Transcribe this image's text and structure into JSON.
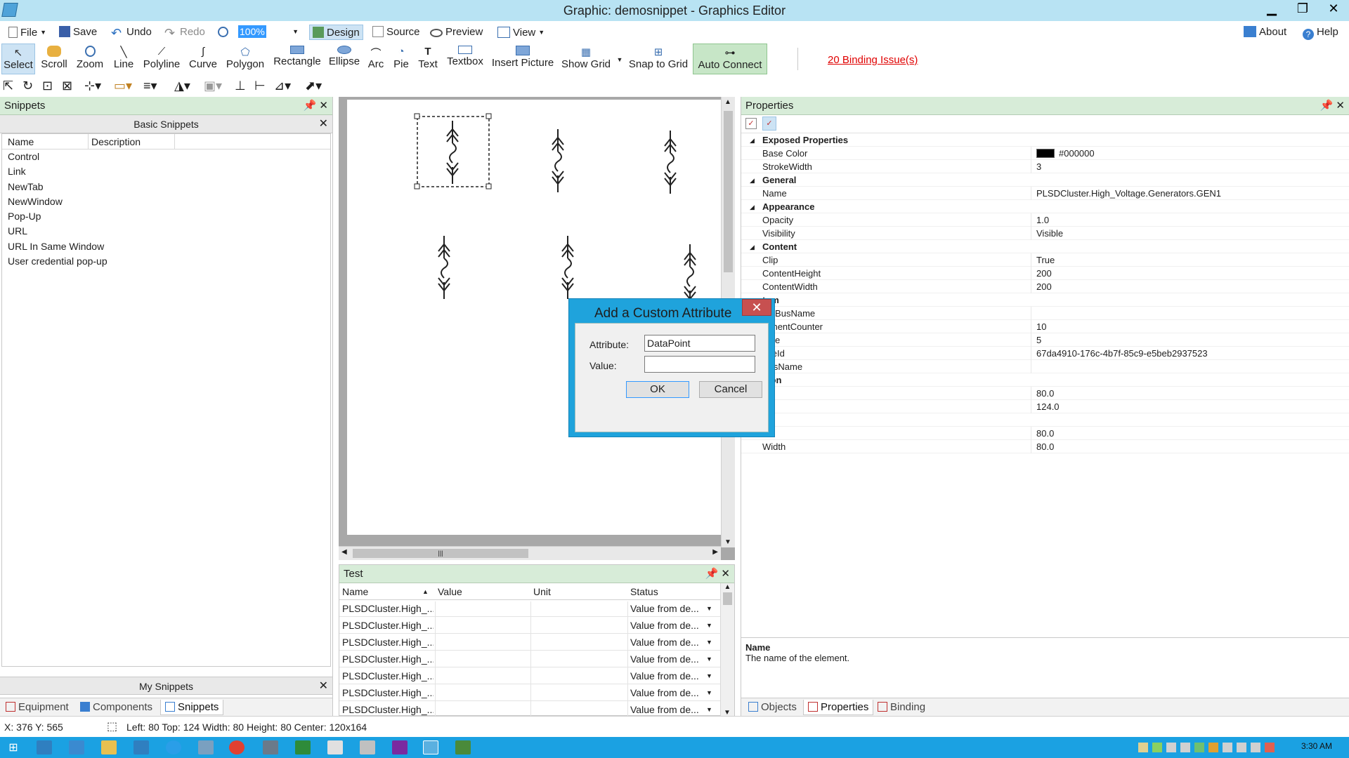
{
  "window": {
    "title": "Graphic: demosnippet - Graphics Editor",
    "min": "▁",
    "max": "❐",
    "close": "✕"
  },
  "menu": {
    "file": "File",
    "save": "Save",
    "undo": "Undo",
    "redo": "Redo",
    "zoom": "100%",
    "design": "Design",
    "source": "Source",
    "preview": "Preview",
    "view": "View",
    "about": "About",
    "help": "Help"
  },
  "tools": [
    {
      "label": "Select",
      "icon": "arrow-icon"
    },
    {
      "label": "Scroll",
      "icon": "hand-icon"
    },
    {
      "label": "Zoom",
      "icon": "magnifier-icon"
    },
    {
      "label": "Line",
      "icon": "line-icon"
    },
    {
      "label": "Polyline",
      "icon": "polyline-icon"
    },
    {
      "label": "Curve",
      "icon": "curve-icon"
    },
    {
      "label": "Polygon",
      "icon": "polygon-icon"
    },
    {
      "label": "Rectangle",
      "icon": "rectangle-icon"
    },
    {
      "label": "Ellipse",
      "icon": "ellipse-icon"
    },
    {
      "label": "Arc",
      "icon": "arc-icon"
    },
    {
      "label": "Pie",
      "icon": "pie-icon"
    },
    {
      "label": "Text",
      "icon": "text-icon"
    },
    {
      "label": "Textbox",
      "icon": "textbox-icon"
    },
    {
      "label": "Insert Picture",
      "icon": "picture-icon"
    },
    {
      "label": "Show Grid",
      "icon": "grid-icon"
    },
    {
      "label": "Snap to Grid",
      "icon": "snap-icon"
    },
    {
      "label": "Auto Connect",
      "icon": "connect-icon"
    }
  ],
  "binding_issues": "20 Binding Issue(s)",
  "snippets": {
    "title": "Snippets",
    "basic_title": "Basic Snippets",
    "col_name": "Name",
    "col_desc": "Description",
    "items": [
      "Control",
      "Link",
      "NewTab",
      "NewWindow",
      "Pop-Up",
      "URL",
      "URL In Same Window",
      "User credential pop-up"
    ],
    "my_snippets": "My Snippets",
    "tabs": [
      "Equipment",
      "Components",
      "Snippets"
    ]
  },
  "test": {
    "title": "Test",
    "columns": [
      "Name",
      "Value",
      "Unit",
      "Status"
    ],
    "rows": [
      {
        "name": "PLSDCluster.High_...",
        "value": "",
        "unit": "",
        "status": "Value from de..."
      },
      {
        "name": "PLSDCluster.High_...",
        "value": "",
        "unit": "",
        "status": "Value from de..."
      },
      {
        "name": "PLSDCluster.High_...",
        "value": "",
        "unit": "",
        "status": "Value from de..."
      },
      {
        "name": "PLSDCluster.High_...",
        "value": "",
        "unit": "",
        "status": "Value from de..."
      },
      {
        "name": "PLSDCluster.High_...",
        "value": "",
        "unit": "",
        "status": "Value from de..."
      },
      {
        "name": "PLSDCluster.High_...",
        "value": "",
        "unit": "",
        "status": "Value from de..."
      },
      {
        "name": "PLSDCluster.High_...",
        "value": "",
        "unit": "",
        "status": "Value from de..."
      }
    ]
  },
  "properties": {
    "title": "Properties",
    "rows": [
      {
        "cat": true,
        "name": "Exposed Properties"
      },
      {
        "name": "Base Color",
        "value": "#000000",
        "swatch": "#000000"
      },
      {
        "name": "StrokeWidth",
        "value": "3"
      },
      {
        "cat": true,
        "name": "General"
      },
      {
        "name": "Name",
        "value": "PLSDCluster.High_Voltage.Generators.GEN1"
      },
      {
        "cat": true,
        "name": "Appearance"
      },
      {
        "name": "Opacity",
        "value": "1.0"
      },
      {
        "name": "Visibility",
        "value": "Visible"
      },
      {
        "cat": true,
        "name": "Content"
      },
      {
        "name": "Clip",
        "value": "True"
      },
      {
        "name": "ContentHeight",
        "value": "200"
      },
      {
        "name": "ContentWidth",
        "value": "200"
      },
      {
        "cat": true,
        "name": "tom"
      },
      {
        "name": "omBusName",
        "value": ""
      },
      {
        "name": "ponentCounter",
        "value": "10"
      },
      {
        "name": "Size",
        "value": "5"
      },
      {
        "name": "nceId",
        "value": "67da4910-176c-4b7f-85c9-e5beb2937523"
      },
      {
        "name": "BusName",
        "value": ""
      },
      {
        "cat": true,
        "name": "ition"
      },
      {
        "name": "",
        "value": "80.0"
      },
      {
        "name": "",
        "value": "124.0"
      },
      {
        "cat": true,
        "name": "e"
      },
      {
        "name": "ht",
        "value": "80.0"
      },
      {
        "name": "Width",
        "value": "80.0"
      }
    ],
    "desc_title": "Name",
    "desc_text": "The name of the element.",
    "tabs": [
      "Objects",
      "Properties",
      "Binding"
    ]
  },
  "dialog": {
    "title": "Add a Custom Attribute",
    "close": "✕",
    "attribute_label": "Attribute:",
    "attribute_value": "DataPoint",
    "value_label": "Value:",
    "value_value": "",
    "ok": "OK",
    "cancel": "Cancel"
  },
  "status": {
    "cursor": "X: 376  Y: 565",
    "geometry": "Left: 80  Top: 124  Width: 80  Height: 80  Center: 120x164"
  },
  "taskbar": {
    "time": "3:30 AM"
  },
  "colors": {
    "accent": "#1ba1e2",
    "panel_header": "#d7ecd8",
    "issue": "#e00000"
  }
}
